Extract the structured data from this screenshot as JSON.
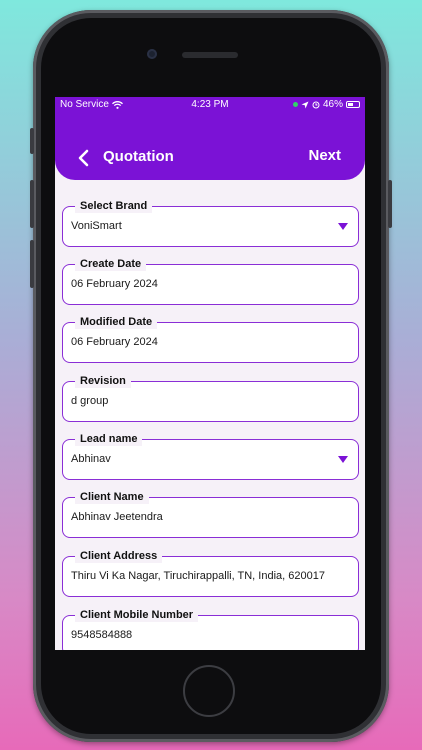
{
  "statusbar": {
    "carrier": "No Service",
    "time": "4:23 PM",
    "battery": "46%",
    "battery_level": 0.46
  },
  "header": {
    "title": "Quotation",
    "next_label": "Next",
    "accent_color": "#7b12d6"
  },
  "fields": [
    {
      "label": "Select Brand",
      "value": "VoniSmart",
      "type": "dropdown"
    },
    {
      "label": "Create Date",
      "value": "06 February 2024",
      "type": "text"
    },
    {
      "label": "Modified Date",
      "value": "06 February 2024",
      "type": "text"
    },
    {
      "label": "Revision",
      "value": "d group",
      "type": "text"
    },
    {
      "label": "Lead name",
      "value": "Abhinav",
      "type": "dropdown"
    },
    {
      "label": "Client Name",
      "value": "Abhinav Jeetendra",
      "type": "text"
    },
    {
      "label": "Client Address",
      "value": "Thiru Vi Ka Nagar, Tiruchirappalli, TN, India, 620017",
      "type": "text"
    },
    {
      "label": "Client Mobile Number",
      "value": "9548584888",
      "type": "text"
    }
  ],
  "icons": {
    "back": "chevron-left-icon",
    "dropdown": "caret-down-icon",
    "wifi": "wifi-icon",
    "location": "location-arrow-icon",
    "battery": "battery-icon"
  }
}
